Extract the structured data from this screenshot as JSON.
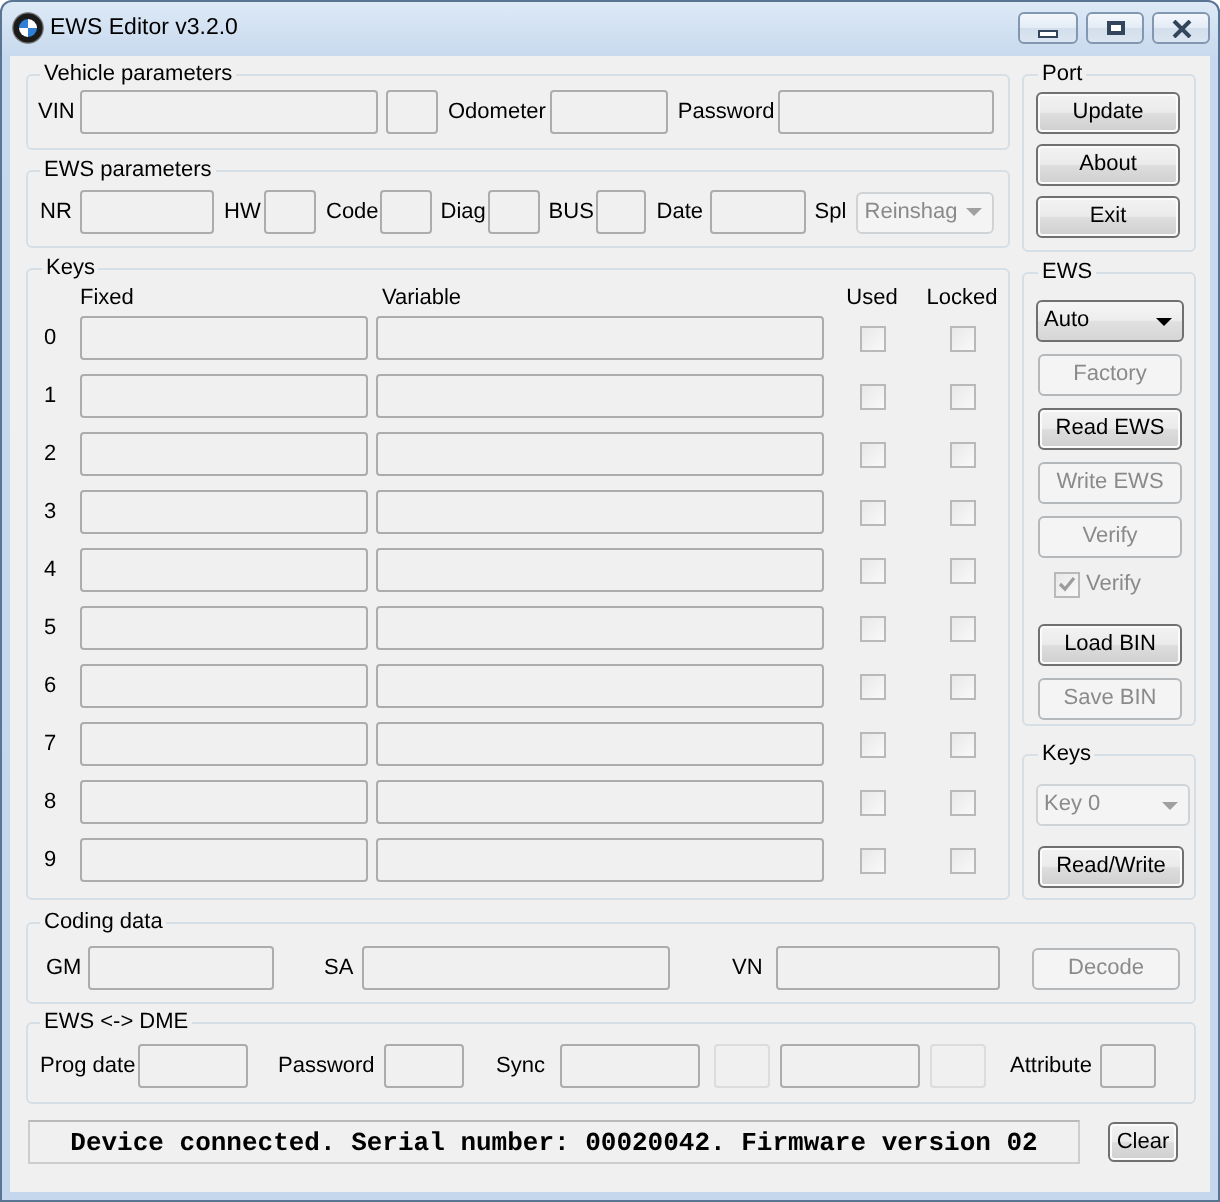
{
  "window": {
    "title": "EWS Editor v3.2.0"
  },
  "vehicle_parameters": {
    "title": "Vehicle parameters",
    "items": [
      {
        "kind": "label",
        "text": "VIN"
      },
      {
        "kind": "field"
      },
      {
        "kind": "field"
      },
      {
        "kind": "label",
        "text": "Odometer"
      },
      {
        "kind": "field"
      },
      {
        "kind": "label",
        "text": "Password"
      },
      {
        "kind": "field"
      }
    ]
  },
  "port": {
    "title": "Port",
    "buttons": [
      {
        "label": "Update",
        "disabled": false
      },
      {
        "label": "About",
        "disabled": false
      },
      {
        "label": "Exit",
        "disabled": false
      }
    ]
  },
  "ews_parameters": {
    "title": "EWS parameters",
    "items": [
      {
        "kind": "label",
        "text": "NR"
      },
      {
        "kind": "field"
      },
      {
        "kind": "label",
        "text": "HW"
      },
      {
        "kind": "field"
      },
      {
        "kind": "label",
        "text": "Code"
      },
      {
        "kind": "field"
      },
      {
        "kind": "label",
        "text": "Diag"
      },
      {
        "kind": "field"
      },
      {
        "kind": "label",
        "text": "BUS"
      },
      {
        "kind": "field"
      },
      {
        "kind": "label",
        "text": "Date"
      },
      {
        "kind": "field"
      },
      {
        "kind": "label",
        "text": "Spl"
      },
      {
        "kind": "dropdown",
        "value": "Reinshag",
        "disabled": true
      }
    ]
  },
  "keys": {
    "title": "Keys",
    "columns": [
      "Fixed",
      "Variable",
      "Used",
      "Locked"
    ],
    "rows": [
      {
        "index": "0",
        "used": false,
        "locked": false
      },
      {
        "index": "1",
        "used": false,
        "locked": false
      },
      {
        "index": "2",
        "used": false,
        "locked": false
      },
      {
        "index": "3",
        "used": false,
        "locked": false
      },
      {
        "index": "4",
        "used": false,
        "locked": false
      },
      {
        "index": "5",
        "used": false,
        "locked": false
      },
      {
        "index": "6",
        "used": false,
        "locked": false
      },
      {
        "index": "7",
        "used": false,
        "locked": false
      },
      {
        "index": "8",
        "used": false,
        "locked": false
      },
      {
        "index": "9",
        "used": false,
        "locked": false
      }
    ]
  },
  "ews": {
    "title": "EWS",
    "controls": [
      {
        "kind": "dropdown",
        "value": "Auto",
        "disabled": false
      },
      {
        "kind": "button",
        "label": "Factory",
        "disabled": true
      },
      {
        "kind": "button",
        "label": "Read EWS",
        "disabled": false
      },
      {
        "kind": "button",
        "label": "Write EWS",
        "disabled": true
      },
      {
        "kind": "button",
        "label": "Verify",
        "disabled": true
      },
      {
        "kind": "checkbox",
        "label": "Verify",
        "checked": true,
        "disabled": true
      },
      {
        "kind": "button",
        "label": "Load BIN",
        "disabled": false
      },
      {
        "kind": "button",
        "label": "Save BIN",
        "disabled": true
      }
    ]
  },
  "key_access": {
    "title": "Keys",
    "controls": [
      {
        "kind": "dropdown",
        "value": "Key 0",
        "disabled": true
      },
      {
        "kind": "button",
        "label": "Read/Write",
        "disabled": false
      }
    ]
  },
  "coding_data": {
    "title": "Coding data",
    "items": [
      {
        "kind": "label",
        "text": "GM"
      },
      {
        "kind": "field"
      },
      {
        "kind": "label",
        "text": "SA"
      },
      {
        "kind": "field"
      },
      {
        "kind": "label",
        "text": "VN"
      },
      {
        "kind": "field"
      },
      {
        "kind": "button",
        "label": "Decode",
        "disabled": true
      }
    ]
  },
  "ews_dme": {
    "title": "EWS <-> DME",
    "items": [
      {
        "kind": "label",
        "text": "Prog date"
      },
      {
        "kind": "field",
        "disabled": false
      },
      {
        "kind": "label",
        "text": "Password"
      },
      {
        "kind": "field",
        "disabled": false
      },
      {
        "kind": "label",
        "text": "Sync"
      },
      {
        "kind": "field",
        "disabled": false
      },
      {
        "kind": "field",
        "disabled": true
      },
      {
        "kind": "field",
        "disabled": false
      },
      {
        "kind": "field",
        "disabled": true
      },
      {
        "kind": "label",
        "text": "Attribute"
      },
      {
        "kind": "field",
        "disabled": false
      }
    ]
  },
  "status_bar": {
    "message": "Device connected. Serial number: 00020042. Firmware version 02",
    "button": {
      "label": "Clear",
      "disabled": false
    }
  }
}
